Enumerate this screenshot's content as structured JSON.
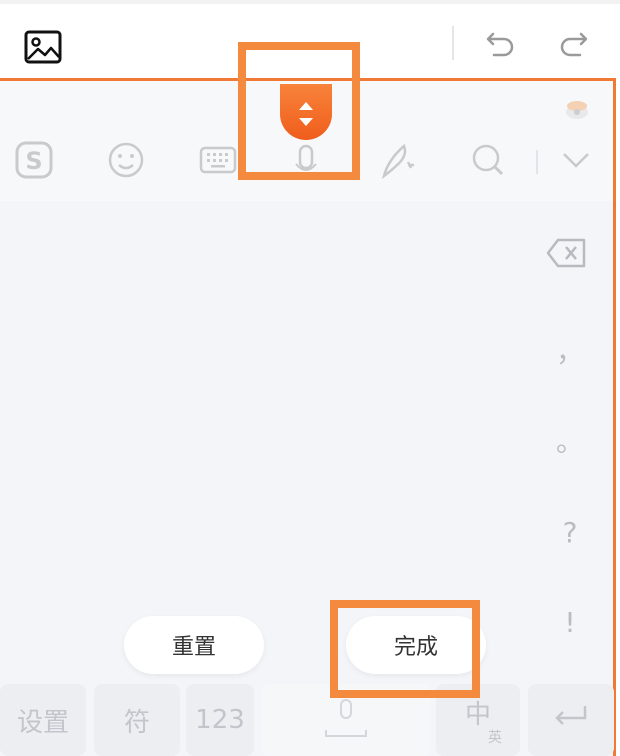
{
  "toolbar": {
    "image_icon": "image-icon",
    "undo_icon": "undo-icon",
    "redo_icon": "redo-icon"
  },
  "keyboard_toolbar": {
    "icons": [
      "sogou-logo-icon",
      "emoji-icon",
      "keyboard-icon",
      "microphone-icon",
      "handwriting-icon",
      "search-icon",
      "collapse-chevron-icon"
    ]
  },
  "drag_handle": {
    "icon": "resize-arrows-icon"
  },
  "side_column": {
    "backspace_icon": "backspace-icon",
    "keys": [
      "，",
      "。",
      "?",
      "!"
    ]
  },
  "buttons": {
    "reset_label": "重置",
    "done_label": "完成"
  },
  "bottom_row": {
    "settings_label": "设置",
    "symbols_label": "符",
    "numbers_label": "123",
    "lang_label": "中",
    "lang_sub": "英",
    "enter_icon": "enter-icon"
  },
  "colors": {
    "accent": "#f07a35",
    "highlight": "#f48a3d"
  }
}
